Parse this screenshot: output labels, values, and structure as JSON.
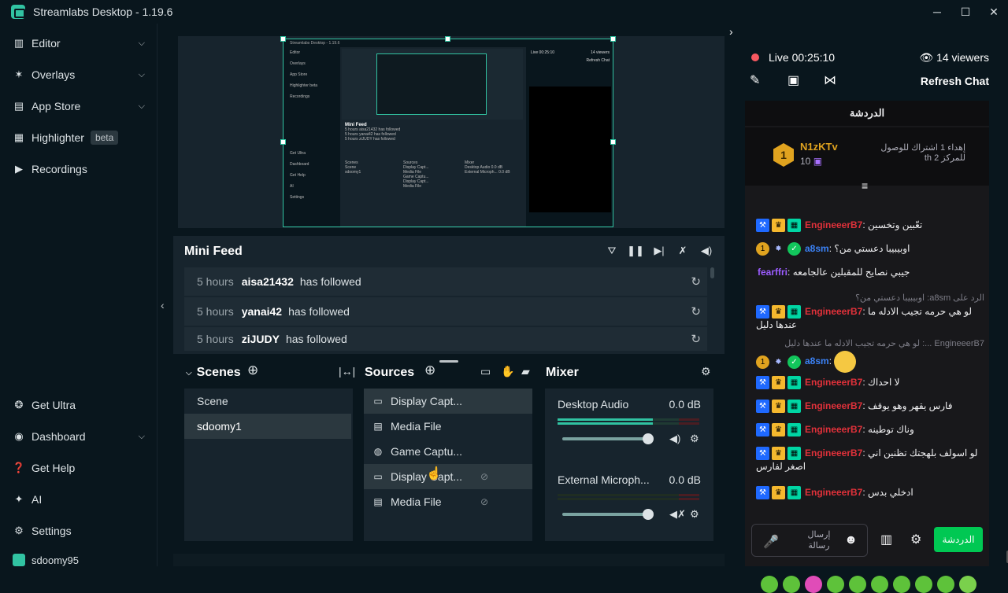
{
  "window": {
    "title": "Streamlabs Desktop - 1.19.6",
    "controls": [
      "─",
      "☐",
      "✕"
    ]
  },
  "sidebar": {
    "top_items": [
      {
        "label": "Editor",
        "icon": "editor-icon",
        "has_chevron": true
      },
      {
        "label": "Overlays",
        "icon": "overlays-icon",
        "has_chevron": true
      },
      {
        "label": "App Store",
        "icon": "store-icon",
        "has_chevron": true
      },
      {
        "label": "Highlighter",
        "icon": "highlighter-icon",
        "badge": "beta"
      },
      {
        "label": "Recordings",
        "icon": "recordings-icon"
      }
    ],
    "bottom_items": [
      {
        "label": "Get Ultra",
        "icon": "ultra-icon"
      },
      {
        "label": "Dashboard",
        "icon": "dashboard-icon",
        "has_chevron": true
      },
      {
        "label": "Get Help",
        "icon": "help-icon"
      },
      {
        "label": "AI",
        "icon": "ai-icon"
      },
      {
        "label": "Settings",
        "icon": "settings-icon"
      }
    ],
    "account": "sdoomy95"
  },
  "preview": {
    "window_title": "Streamlabs Desktop - 1.19.6",
    "mini_sidebar": [
      "Editor",
      "Overlays",
      "App Store",
      "Highlighter beta",
      "Recordings"
    ],
    "mini_sidebar_bottom": [
      "Get Ultra",
      "Dashboard",
      "Get Help",
      "AI",
      "Settings"
    ],
    "mini_feed_title": "Mini Feed",
    "mini_feed_rows": [
      "5 hours  aisa21432 has followed",
      "5 hours  yanai42 has followed",
      "5 hours  ziJUDY has followed"
    ],
    "mini_scenes": [
      "Scenes",
      "Scene",
      "sdoomy1"
    ],
    "mini_sources": [
      "Sources",
      "Display Capt...",
      "Media File",
      "Game Captu...",
      "Display Capt...",
      "Media File"
    ],
    "mini_mixer": [
      "Mixer",
      "Desktop Audio 0.0 dB",
      "External Microph... 0.0 dB"
    ],
    "mini_chat_header": "Live 00:25:10",
    "mini_chat_viewers": "14 viewers",
    "mini_chat_refresh": "Refresh Chat"
  },
  "minifeed": {
    "title": "Mini Feed",
    "rows": [
      {
        "time": "5 hours",
        "user": "aisa21432",
        "action": "has followed"
      },
      {
        "time": "5 hours",
        "user": "yanai42",
        "action": "has followed"
      },
      {
        "time": "5 hours",
        "user": "ziJUDY",
        "action": "has followed"
      }
    ]
  },
  "scenes": {
    "title": "Scenes",
    "items": [
      {
        "label": "Scene",
        "selected": false
      },
      {
        "label": "sdoomy1",
        "selected": true
      }
    ]
  },
  "sources": {
    "title": "Sources",
    "items": [
      {
        "label": "Display Capt...",
        "icon": "display-icon",
        "selected": true
      },
      {
        "label": "Media File",
        "icon": "file-icon"
      },
      {
        "label": "Game Captu...",
        "icon": "gamepad-icon"
      },
      {
        "label": "Display Capt...",
        "icon": "display-icon",
        "hidden": true
      },
      {
        "label": "Media File",
        "icon": "file-icon",
        "hidden": true
      }
    ]
  },
  "mixer": {
    "title": "Mixer",
    "channels": [
      {
        "name": "Desktop Audio",
        "db": "0.0 dB",
        "level": 0.67,
        "muted": false
      },
      {
        "name": "External Microph...",
        "db": "0.0 dB",
        "level": 0.0,
        "muted": true
      }
    ]
  },
  "chat": {
    "live_label": "Live",
    "live_time": "00:25:10",
    "viewers": "14 viewers",
    "refresh_label": "Refresh Chat",
    "header": "الدردشة",
    "pinned": {
      "badge_number": "1",
      "name": "N1zKTv",
      "count": "10",
      "text": "إهداء 1 اشتراك للوصول للمركز 2 th"
    },
    "messages": [
      {
        "name": "EngineeerB7",
        "color": "red",
        "badges": [
          "hammer",
          "crown",
          "grid"
        ],
        "text": "تعّبين وتخسين"
      },
      {
        "name": "a8sm",
        "color": "blue",
        "badges": [
          "one",
          "star",
          "check"
        ],
        "text": "اوبيبيبا دعستي من؟"
      },
      {
        "name": "fearffri",
        "color": "purple",
        "badges": [],
        "text": "جيبي نصايح للمقبلين عالجامعه"
      },
      {
        "reply": "الرد على a8sm: اوبيبيبا دعستي من؟"
      },
      {
        "name": "EngineeerB7",
        "color": "red",
        "badges": [
          "hammer",
          "crown",
          "grid"
        ],
        "text": "لو هي حرمه تجيب الادله ما عندها دليل"
      },
      {
        "reply": "EngineeerB7 ...: لو هي حرمه تجيب الادله ما عندها دليل"
      },
      {
        "name": "a8sm",
        "color": "blue",
        "badges": [
          "one",
          "star",
          "check"
        ],
        "text": "",
        "emote": true
      },
      {
        "name": "EngineeerB7",
        "color": "red",
        "badges": [
          "hammer",
          "crown",
          "grid"
        ],
        "text": "لا احداك"
      },
      {
        "name": "EngineeerB7",
        "color": "red",
        "badges": [
          "hammer",
          "crown",
          "grid"
        ],
        "text": "فارس يقهر وهو يوقف"
      },
      {
        "name": "EngineeerB7",
        "color": "red",
        "badges": [
          "hammer",
          "crown",
          "grid"
        ],
        "text": "وناك توطينه"
      },
      {
        "name": "EngineeerB7",
        "color": "red",
        "badges": [
          "hammer",
          "crown",
          "grid"
        ],
        "text": "لو اسولف بلهجتك تظنين اني اصغر لفارس"
      },
      {
        "name": "EngineeerB7",
        "color": "red",
        "badges": [
          "hammer",
          "crown",
          "grid"
        ],
        "text": "ادخلي بدس"
      }
    ],
    "input_placeholder": "إرسال رسالة",
    "send_label": "الدردشة"
  },
  "colors": {
    "accent": "#31c3a2",
    "background": "#09161d",
    "panel": "#17242d",
    "live": "#f85961"
  }
}
